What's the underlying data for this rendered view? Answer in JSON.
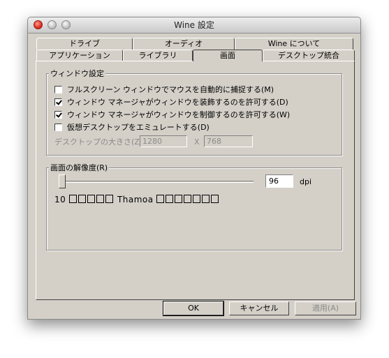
{
  "window": {
    "title": "Wine 設定"
  },
  "tabs": {
    "back_row": [
      "ドライブ",
      "オーディオ",
      "Wine について"
    ],
    "front_row": [
      "アプリケーション",
      "ライブラリ",
      "画面",
      "デスクトップ統合"
    ],
    "active": "画面"
  },
  "window_settings": {
    "legend": "ウィンドウ設定",
    "options": [
      {
        "label": "フルスクリーン ウィンドウでマウスを自動的に捕捉する(M)",
        "checked": false
      },
      {
        "label": "ウィンドウ マネージャがウィンドウを装飾するのを許可する(D)",
        "checked": true
      },
      {
        "label": "ウィンドウ マネージャがウィンドウを制御するのを許可する(W)",
        "checked": true
      },
      {
        "label": "仮想デスクトップをエミュレートする(D)",
        "checked": false
      }
    ],
    "desktop_size_label": "デスクトップの大きさ(Z):",
    "width_value": "1280",
    "separator": "X",
    "height_value": "768"
  },
  "resolution": {
    "legend": "画面の解像度(R)",
    "slider_value": 0,
    "dpi_value": "96",
    "dpi_unit": "dpi",
    "sample_prefix": "10",
    "sample_font": "Thamoa",
    "boxes_before": 5,
    "boxes_after": 7
  },
  "buttons": {
    "ok": "OK",
    "cancel": "キャンセル",
    "apply": "適用(A)"
  }
}
